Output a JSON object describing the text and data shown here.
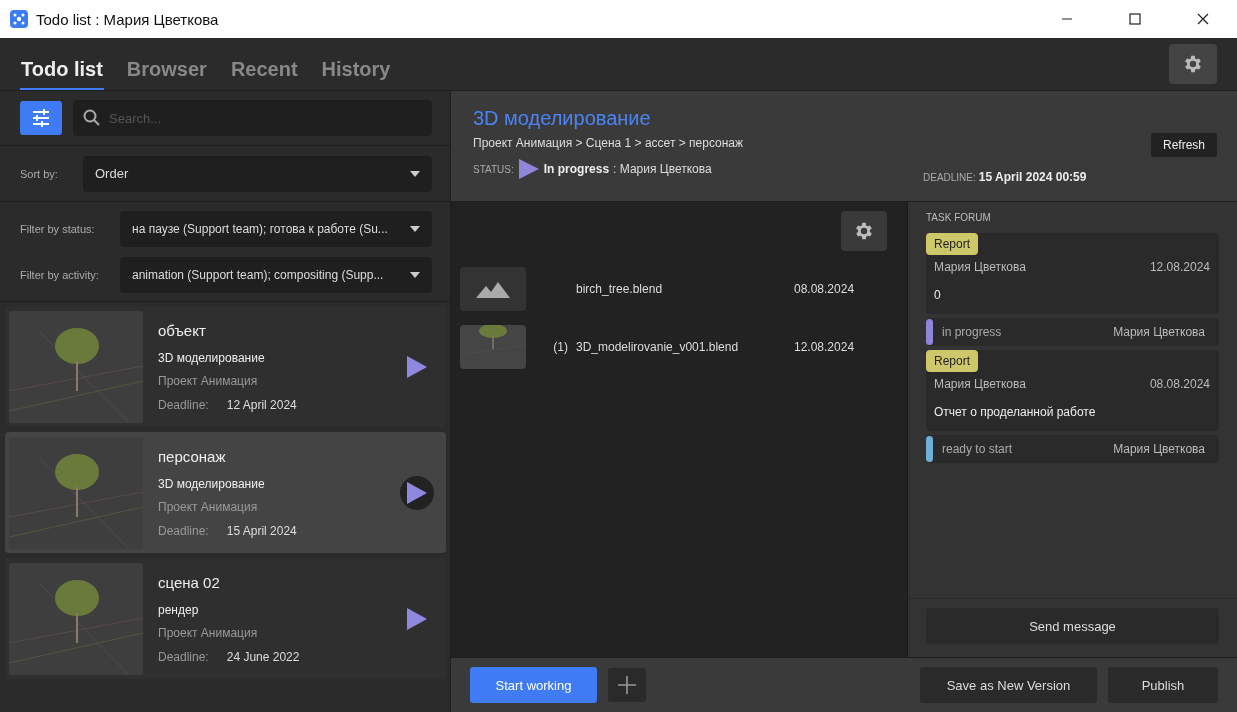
{
  "window": {
    "title": "Todo list : Мария Цветкова"
  },
  "tabs": [
    {
      "label": "Todo list",
      "selected": true
    },
    {
      "label": "Browser",
      "selected": false
    },
    {
      "label": "Recent",
      "selected": false
    },
    {
      "label": "History",
      "selected": false
    }
  ],
  "search": {
    "placeholder": "Search..."
  },
  "sort": {
    "label": "Sort by:",
    "value": "Order"
  },
  "filters": [
    {
      "label": "Filter by status:",
      "value": "на паузе (Support team); готова к работе (Su..."
    },
    {
      "label": "Filter by activity:",
      "value": "animation (Support team); compositing (Supp..."
    }
  ],
  "tasks": [
    {
      "name": "объект",
      "activity": "3D моделирование",
      "project": "Проект Анимация",
      "deadline_label": "Deadline:",
      "deadline": "12 April 2024",
      "selected": false
    },
    {
      "name": "персонаж",
      "activity": "3D моделирование",
      "project": "Проект Анимация",
      "deadline_label": "Deadline:",
      "deadline": "15 April 2024",
      "selected": true
    },
    {
      "name": "сцена 02",
      "activity": "рендер",
      "project": "Проект Анимация",
      "deadline_label": "Deadline:",
      "deadline": "24 June 2022",
      "selected": false
    }
  ],
  "detail": {
    "title": "3D моделирование",
    "path": "Проект Анимация > Сцена 1 > ассет > персонаж",
    "status_label": "STATUS:",
    "status": "In progress",
    "assignee": ": Мария Цветкова",
    "deadline_label": "DEADLINE:",
    "deadline": "15 April 2024 00:59",
    "refresh": "Refresh"
  },
  "files": [
    {
      "kind": "placeholder",
      "name": "birch_tree.blend",
      "date": "08.08.2024"
    },
    {
      "kind": "preview",
      "version": "(1)",
      "name": "3D_modelirovanie_v001.blend",
      "date": "12.08.2024"
    }
  ],
  "forum": {
    "title": "TASK FORUM",
    "entries": [
      {
        "kind": "report",
        "tag": "Report",
        "author": "Мария Цветкова",
        "date": "12.08.2024",
        "text": "0"
      },
      {
        "kind": "status",
        "status": "in progress",
        "color": "#8f86d9",
        "author": "Мария Цветкова"
      },
      {
        "kind": "report",
        "tag": "Report",
        "author": "Мария Цветкова",
        "date": "08.08.2024",
        "text": "Отчет о проделанной работе"
      },
      {
        "kind": "status",
        "status": "ready to start",
        "color": "#6fb0d6",
        "author": "Мария Цветкова"
      }
    ],
    "send": "Send message"
  },
  "actions": {
    "start": "Start working",
    "save": "Save as New Version",
    "publish": "Publish"
  }
}
